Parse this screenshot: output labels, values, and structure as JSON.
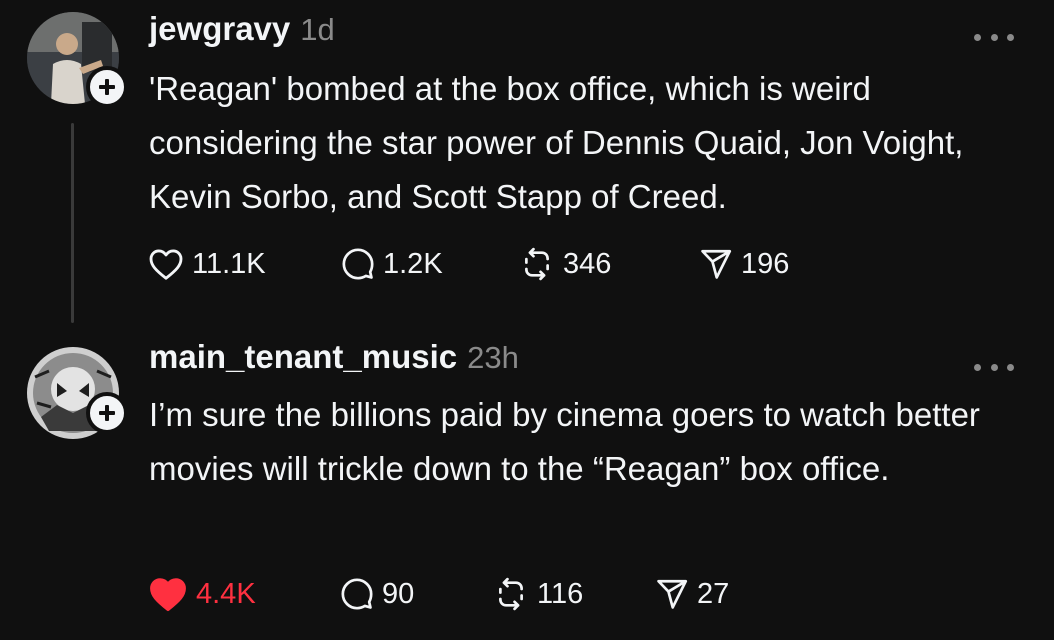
{
  "posts": [
    {
      "username": "jewgravy",
      "timestamp": "1d",
      "text": "'Reagan' bombed at the box office, which is weird considering the star power of Dennis Quaid, Jon Voight, Kevin Sorbo, and Scott Stapp of Creed.",
      "likes": "11.1K",
      "replies": "1.2K",
      "reposts": "346",
      "shares": "196",
      "liked": false
    },
    {
      "username": "main_tenant_music",
      "timestamp": "23h",
      "text": "I’m sure the billions paid by cinema goers to watch better movies will trickle down to the “Reagan” box office.",
      "likes": "4.4K",
      "replies": "90",
      "reposts": "116",
      "shares": "27",
      "liked": true
    }
  ],
  "icons": {
    "like": "heart-icon",
    "reply": "speech-bubble-icon",
    "repost": "repost-icon",
    "share": "send-icon",
    "more": "more-dots-icon",
    "follow": "plus-icon"
  },
  "colors": {
    "background": "#101010",
    "text": "#f3f5f7",
    "muted": "#8a8a8a",
    "liked": "#ff3040"
  }
}
